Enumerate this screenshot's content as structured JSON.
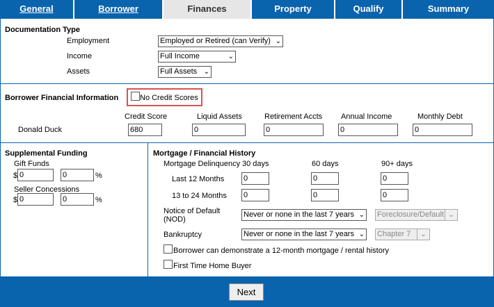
{
  "tabs": [
    {
      "label": "General"
    },
    {
      "label": "Borrower"
    },
    {
      "label": "Finances"
    },
    {
      "label": "Property"
    },
    {
      "label": "Qualify"
    },
    {
      "label": "Summary"
    }
  ],
  "documentation": {
    "title": "Documentation Type",
    "employment_label": "Employment",
    "employment_value": "Employed or Retired (can Verify)",
    "income_label": "Income",
    "income_value": "Full Income",
    "assets_label": "Assets",
    "assets_value": "Full Assets"
  },
  "borrower_financial": {
    "title": "Borrower Financial Information",
    "no_credit_label": "No Credit Scores",
    "columns": [
      "Credit Score",
      "Liquid Assets",
      "Retirement Accts",
      "Annual Income",
      "Monthly Debt"
    ],
    "borrower_name": "Donald Duck",
    "values": [
      "680",
      "0",
      "0",
      "0",
      "0"
    ]
  },
  "supplemental": {
    "title": "Supplemental Funding",
    "gift_funds_label": "Gift Funds",
    "gift_amount": "0",
    "gift_percent": "0",
    "seller_label": "Seller Concessions",
    "seller_amount": "0",
    "seller_percent": "0",
    "currency_symbol": "$",
    "percent_symbol": "%"
  },
  "mortgage_history": {
    "title": "Mortgage / Financial History",
    "delinquency_label": "Mortgage Delinquency",
    "col_30": "30 days",
    "col_60": "60 days",
    "col_90": "90+ days",
    "row1_label": "Last 12 Months",
    "row2_label": "13 to 24 Months",
    "row1_values": [
      "0",
      "0",
      "0"
    ],
    "row2_values": [
      "0",
      "0",
      "0"
    ],
    "nod_label_line1": "Notice of Default",
    "nod_label_line2": "(NOD)",
    "nod_value": "Never or none in the last 7 years",
    "nod_type_value": "Foreclosure/Default",
    "bankruptcy_label": "Bankruptcy",
    "bankruptcy_value": "Never or none in the last 7 years",
    "bankruptcy_type_value": "Chapter 7",
    "rental_history_label": "Borrower can demonstrate a 12-month mortgage / rental history",
    "first_time_label": "First Time Home Buyer"
  },
  "footer": {
    "next_label": "Next"
  },
  "colors": {
    "primary": "#0a63ad",
    "highlight": "#d9534f"
  }
}
